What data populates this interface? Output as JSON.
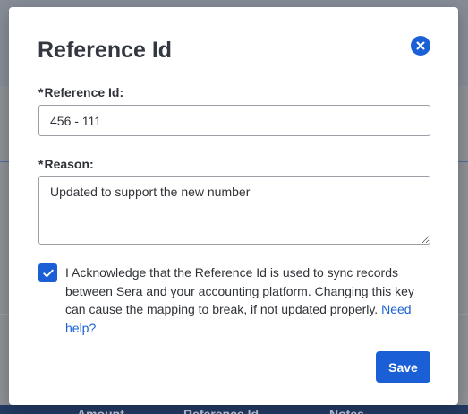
{
  "modal": {
    "title": "Reference Id",
    "close_icon": "close-circle-icon",
    "reference_field": {
      "label": "Reference Id:",
      "required_marker": "*",
      "value": "456 - 111"
    },
    "reason_field": {
      "label": "Reason:",
      "required_marker": "*",
      "value": "Updated to support the new number"
    },
    "acknowledge": {
      "checked": true,
      "text": "I Acknowledge that the Reference Id is used to sync records between Sera and your accounting platform. Changing this key can cause the mapping to break, if not updated properly.",
      "link_text": "Need help?"
    },
    "save_label": "Save"
  },
  "background": {
    "column_headers": [
      "Amount",
      "Reference Id",
      "Notes"
    ]
  },
  "colors": {
    "accent": "#1a5fd6",
    "text": "#2f3237",
    "overlay": "#8e9196"
  }
}
